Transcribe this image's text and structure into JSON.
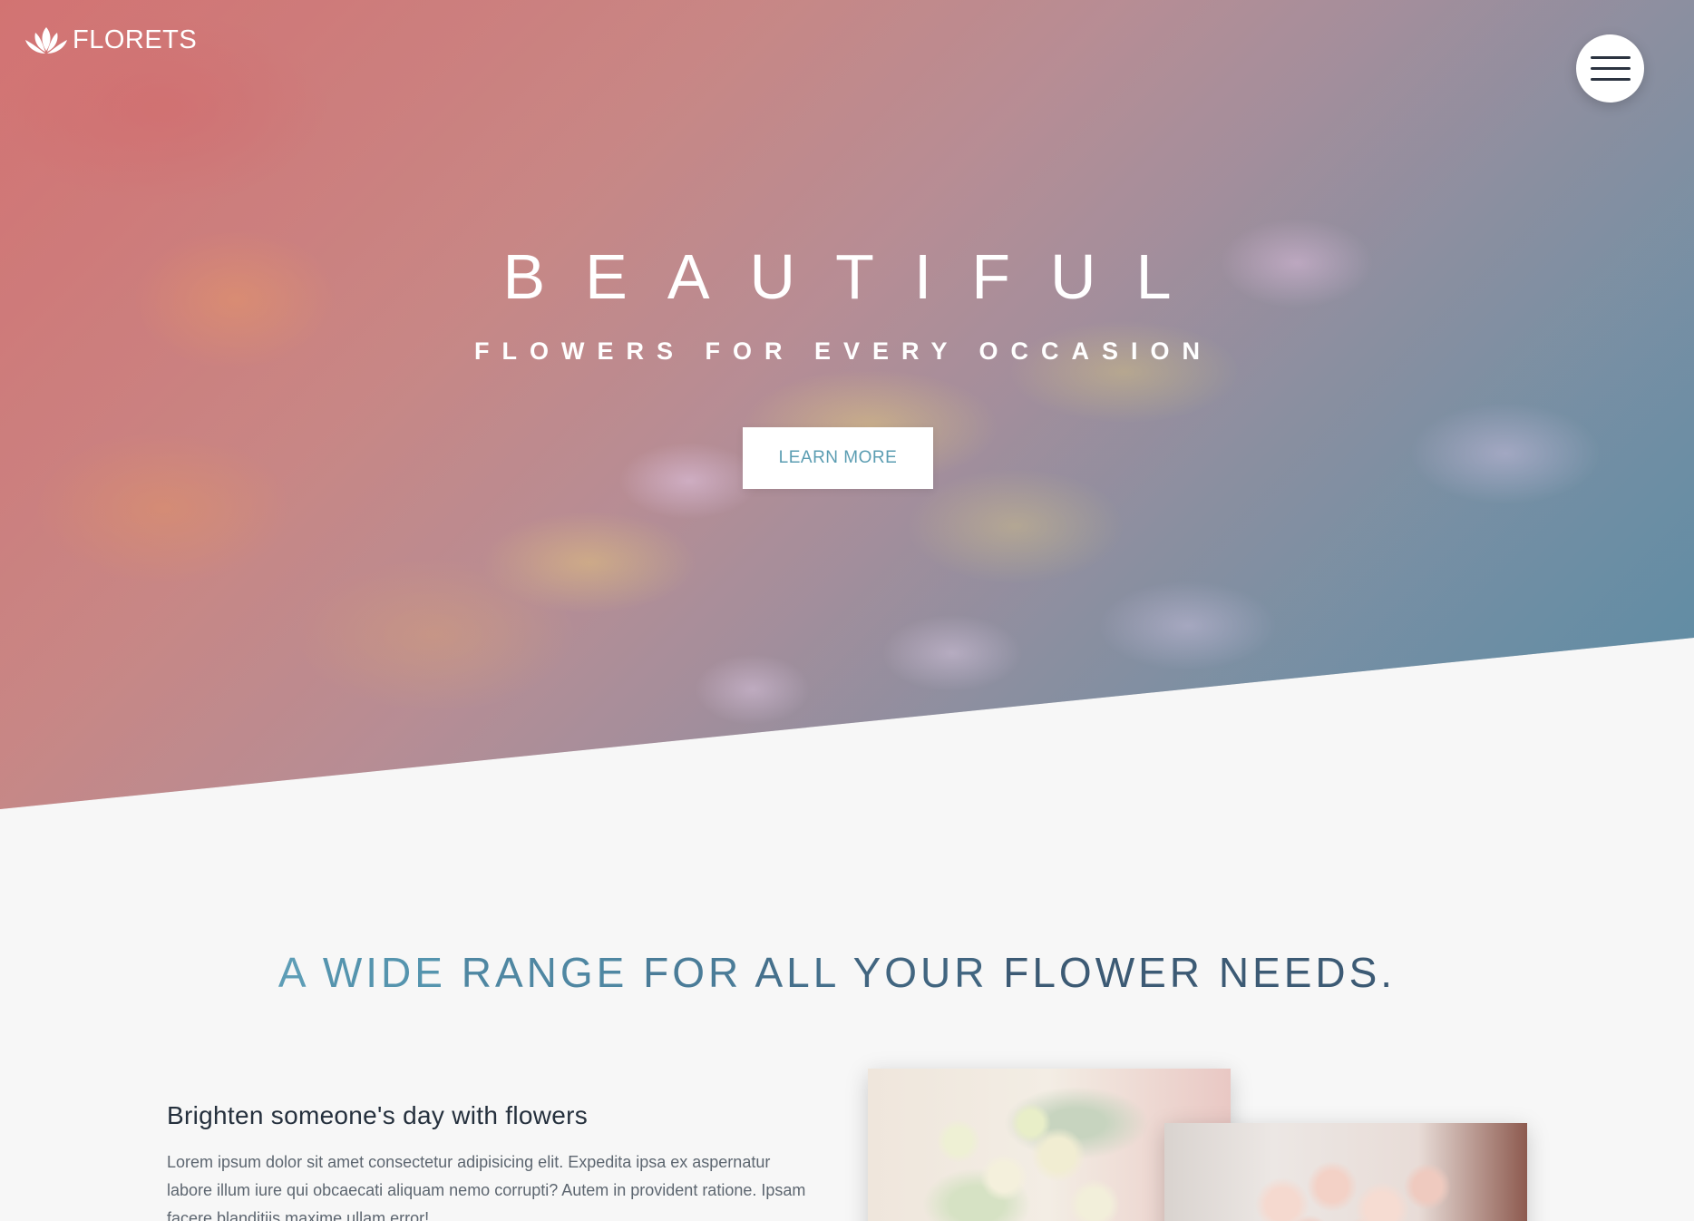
{
  "header": {
    "logo_text": "FLORETS",
    "logo_icon": "lotus-icon",
    "menu_icon": "hamburger-menu-icon"
  },
  "hero": {
    "title": "BEAUTIFUL",
    "subtitle": "FLOWERS FOR EVERY OCCASION",
    "cta_label": "LEARN MORE",
    "accent_color": "#5b9db2"
  },
  "section": {
    "heading_words": [
      "A",
      "WIDE",
      "RANGE",
      "FOR",
      "ALL",
      "YOUR",
      "FLOWER",
      "NEEDS."
    ],
    "feature_title": "Brighten someone's day with flowers",
    "feature_text": "Lorem ipsum dolor sit amet consectetur adipisicing elit. Expedita ipsa ex aspernatur labore illum iure qui obcaecati aliquam nemo corrupti? Autem in provident ratione. Ipsam facere blanditiis maxime ullam error!"
  },
  "colors": {
    "background": "#f7f7f7",
    "heading_start": "#5d9db6",
    "heading_end": "#3c5a74",
    "body_text": "#5d6670",
    "title_text": "#25303d"
  }
}
